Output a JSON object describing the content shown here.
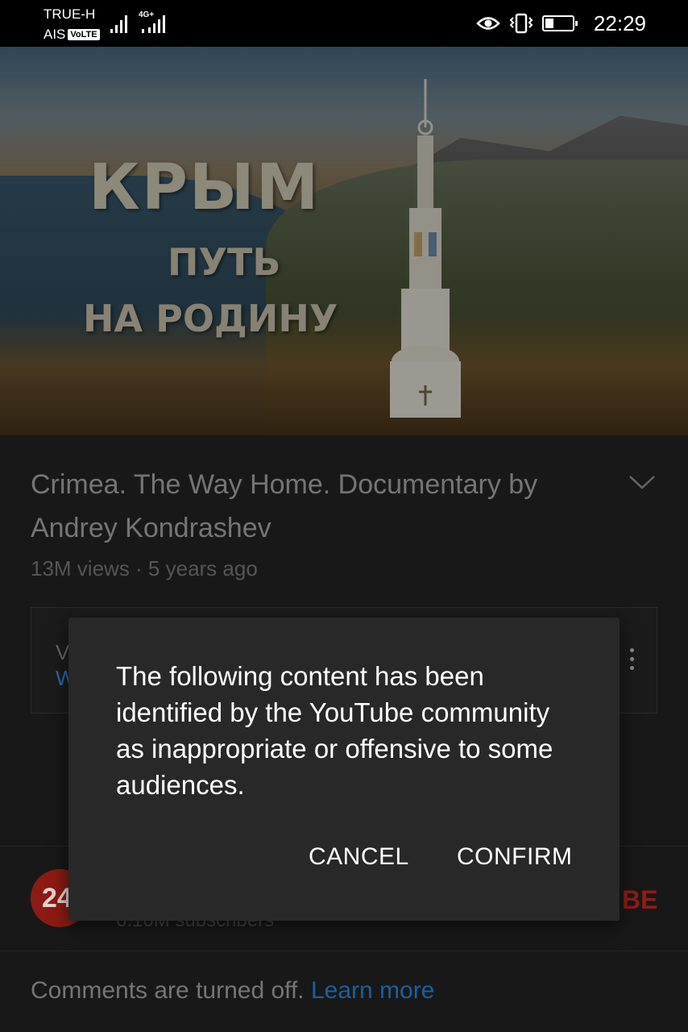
{
  "status_bar": {
    "carrier_1": "TRUE-H",
    "carrier_2": "AIS",
    "volte_badge": "VoLTE",
    "network_type": "4G+",
    "time": "22:29"
  },
  "video": {
    "poster_title": "КРЫМ",
    "poster_subtitle_1": "ПУТЬ",
    "poster_subtitle_2": "НА РОДИНУ"
  },
  "details": {
    "title": "Crimea. The Way Home. Documentary by Andrey Kondrashev",
    "meta": "13M views · 5 years ago",
    "card_line_1": "V",
    "card_line_2": "W"
  },
  "channel": {
    "avatar_text": "24",
    "subscribers": "6.10M subscribers",
    "subscribe_label": "BE"
  },
  "comments": {
    "text": "Comments are turned off.",
    "learn_more": "Learn more"
  },
  "dialog": {
    "message": "The following content has been identified by the YouTube community as inappropriate or offensive to some audiences.",
    "cancel_label": "CANCEL",
    "confirm_label": "CONFIRM"
  },
  "colors": {
    "background": "#181818",
    "dialog_bg": "#282828",
    "link_blue": "#1c5f9e",
    "subscribe_red": "#8e1d16"
  }
}
